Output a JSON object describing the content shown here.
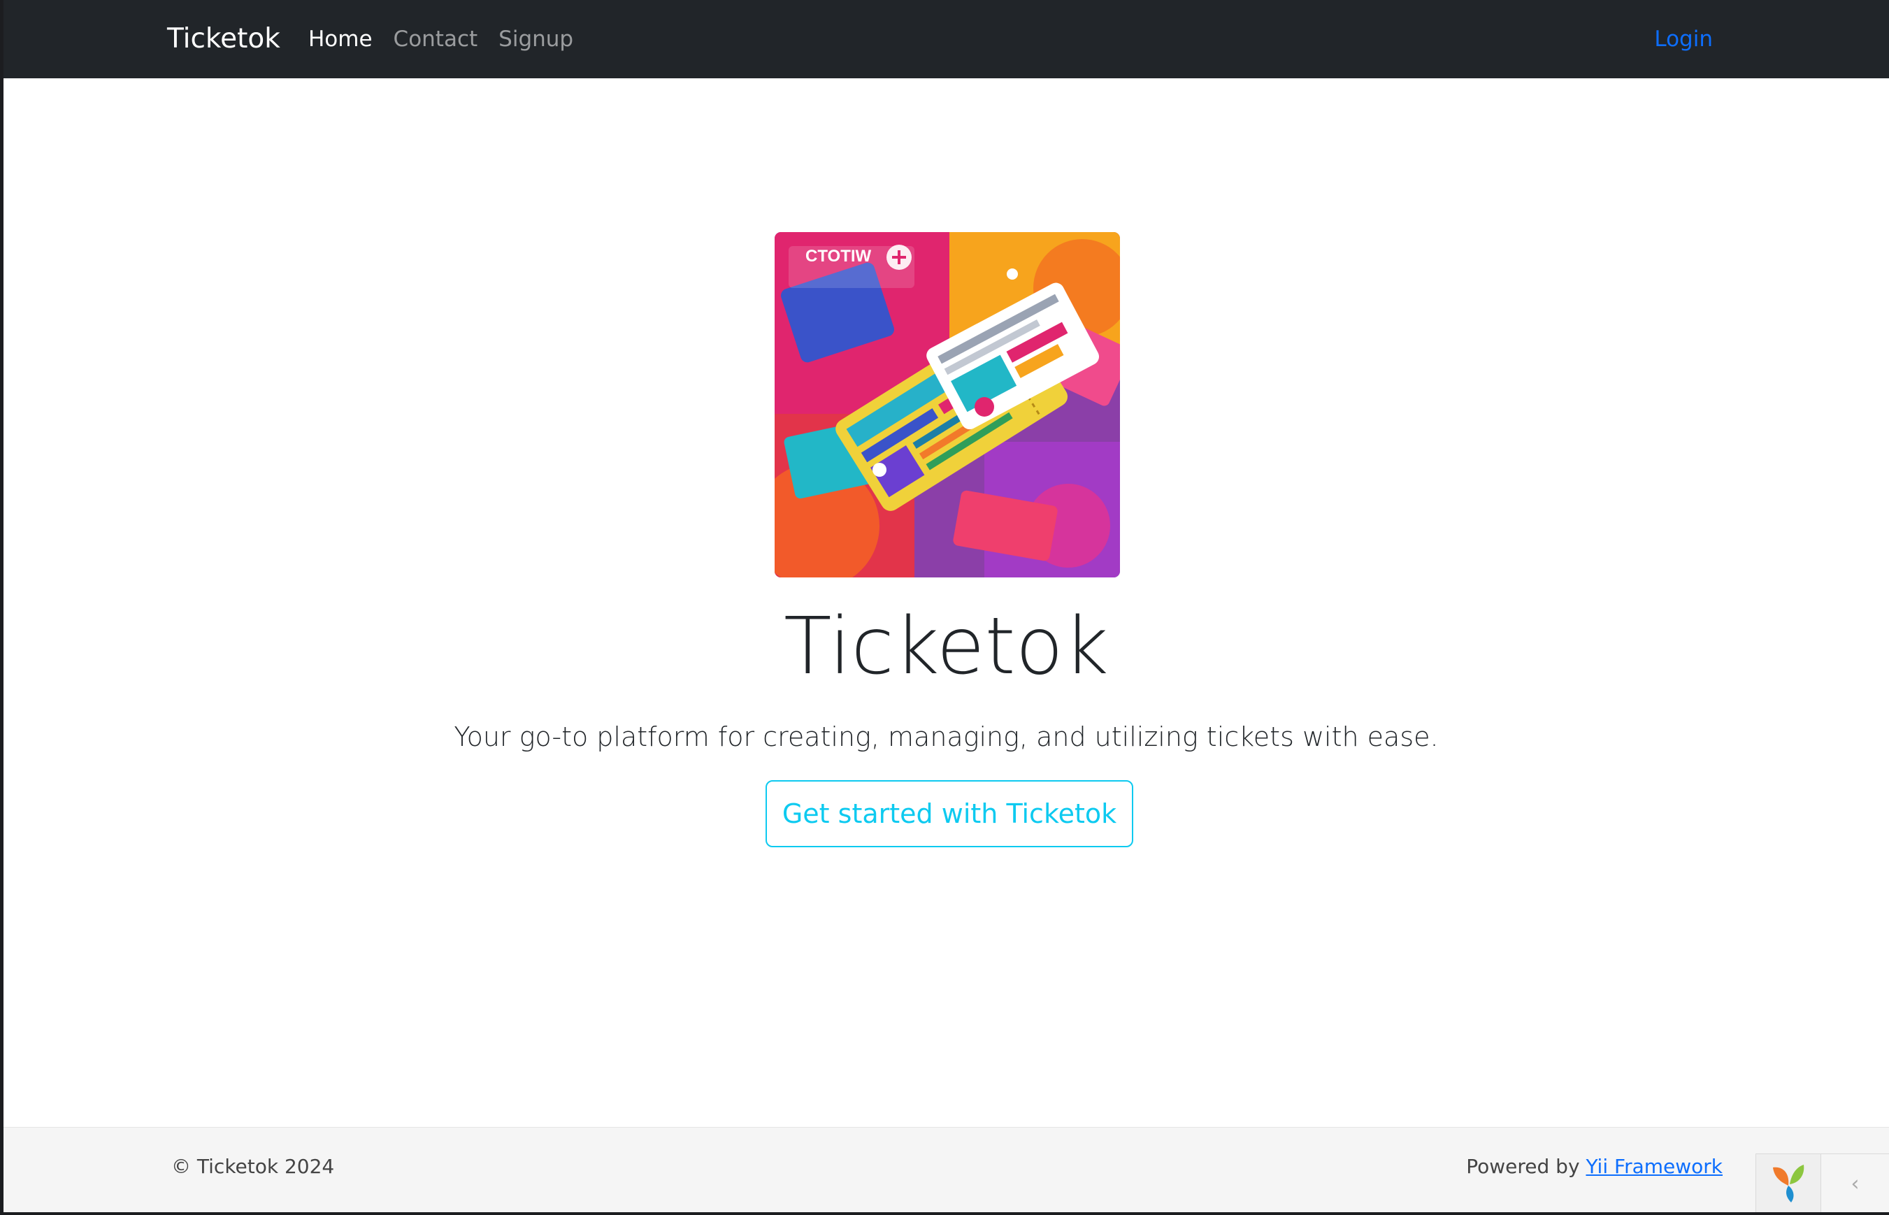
{
  "navbar": {
    "brand": "Ticketok",
    "links": [
      {
        "label": "Home",
        "active": true
      },
      {
        "label": "Contact",
        "active": false
      },
      {
        "label": "Signup",
        "active": false
      }
    ],
    "login": "Login"
  },
  "hero": {
    "image_text": "CTOTIW",
    "title": "Ticketok",
    "lead": "Your go-to platform for creating, managing, and utilizing tickets with ease.",
    "cta": "Get started with Ticketok"
  },
  "footer": {
    "copyright": "© Ticketok 2024",
    "powered_prefix": "Powered by",
    "powered_link": "Yii Framework"
  },
  "debug_toolbar": {
    "logo_icon": "yii-logo-icon",
    "toggle_icon": "chevron-left-icon",
    "toggle_glyph": "‹"
  },
  "colors": {
    "navbar_bg": "#212529",
    "accent_login": "#0d6efd",
    "accent_cta": "#0dcaf0",
    "footer_bg": "#f5f5f5"
  }
}
